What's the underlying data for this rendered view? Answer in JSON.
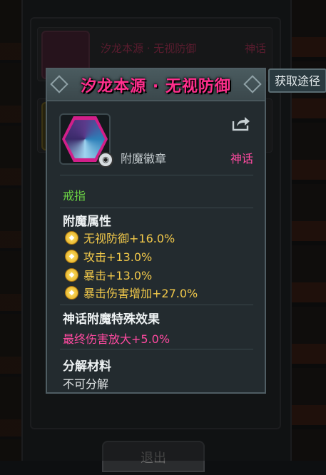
{
  "background": {
    "row_name": "汐龙本源 · 无视防御",
    "row_rarity": "神话",
    "exit_label": "退出"
  },
  "route_button": "获取途径",
  "item": {
    "title": "汐龙本源 · 无视防御",
    "type": "附魔徽章",
    "rarity": "神话",
    "slot": "戒指",
    "attributes_header": "附魔属性",
    "attributes": [
      "无视防御+16.0%",
      "攻击+13.0%",
      "暴击+13.0%",
      "暴击伤害增加+27.0%"
    ],
    "special_header": "神话附魔特殊效果",
    "special_effect": "最终伤害放大+5.0%",
    "decompose_header": "分解材料",
    "decompose_value": "不可分解"
  },
  "colors": {
    "title": "#ff2f8d",
    "rarity": "#ff4aa0",
    "slot": "#6bd244",
    "attribute": "#f2c94a"
  }
}
